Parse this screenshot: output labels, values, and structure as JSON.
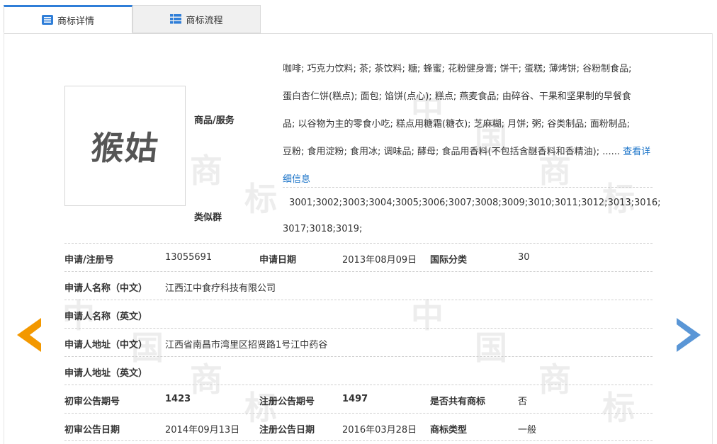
{
  "tabs": [
    {
      "label": "商标详情",
      "icon": "list-icon",
      "active": true
    },
    {
      "label": "商标流程",
      "icon": "grid-icon",
      "active": false
    }
  ],
  "watermark": {
    "chars": [
      "中",
      "国",
      "商",
      "标"
    ]
  },
  "logo": {
    "text": "猴姑"
  },
  "goods_services": {
    "label": "商品/服务",
    "lines": [
      "咖啡; 巧克力饮料; 茶; 茶饮料; 糖; 蜂蜜; 花粉健身膏; 饼干; 蛋糕; 薄烤饼; 谷粉制食品;",
      "蛋白杏仁饼(糕点); 面包; 馅饼(点心); 糕点; 燕麦食品; 由碎谷、干果和坚果制的早餐食",
      "品; 以谷物为主的零食小吃; 糕点用糖霜(糖衣); 芝麻糊; 月饼; 粥; 谷类制品; 面粉制品;",
      "豆粉; 食用淀粉; 食用冰; 调味品; 酵母; 食品用香料(不包括含醚香料和香精油); ......"
    ],
    "more_link": "查看详细信息"
  },
  "similar_groups": {
    "label": "类似群",
    "line1": "3001;3002;3003;3004;3005;3006;3007;3008;3009;3010;3011;3012;3013;3016;",
    "line2": "3017;3018;3019;"
  },
  "fields": {
    "reg_no": {
      "label": "申请/注册号",
      "value": "13055691"
    },
    "apply_date": {
      "label": "申请日期",
      "value": "2013年08月09日"
    },
    "intl_class": {
      "label": "国际分类",
      "value": "30"
    },
    "applicant_cn": {
      "label": "申请人名称（中文）",
      "value": "江西江中食疗科技有限公司"
    },
    "applicant_en": {
      "label": "申请人名称（英文）",
      "value": ""
    },
    "address_cn": {
      "label": "申请人地址（中文）",
      "value": "江西省南昌市湾里区招贤路1号江中药谷"
    },
    "address_en": {
      "label": "申请人地址（英文）",
      "value": ""
    },
    "prelim_issue": {
      "label": "初审公告期号",
      "value": "1423"
    },
    "reg_issue": {
      "label": "注册公告期号",
      "value": "1497"
    },
    "shared": {
      "label": "是否共有商标",
      "value": "否"
    },
    "prelim_date": {
      "label": "初审公告日期",
      "value": "2014年09月13日"
    },
    "reg_date": {
      "label": "注册公告日期",
      "value": "2016年03月28日"
    },
    "mark_type": {
      "label": "商标类型",
      "value": "一般"
    }
  },
  "nav": {
    "prev": "arrow-left-icon",
    "next": "arrow-right-icon"
  },
  "colors": {
    "accent": "#2f7ed8",
    "prev_arrow": "#f39800",
    "next_arrow": "#5a96d6",
    "link": "#1a73c8"
  }
}
